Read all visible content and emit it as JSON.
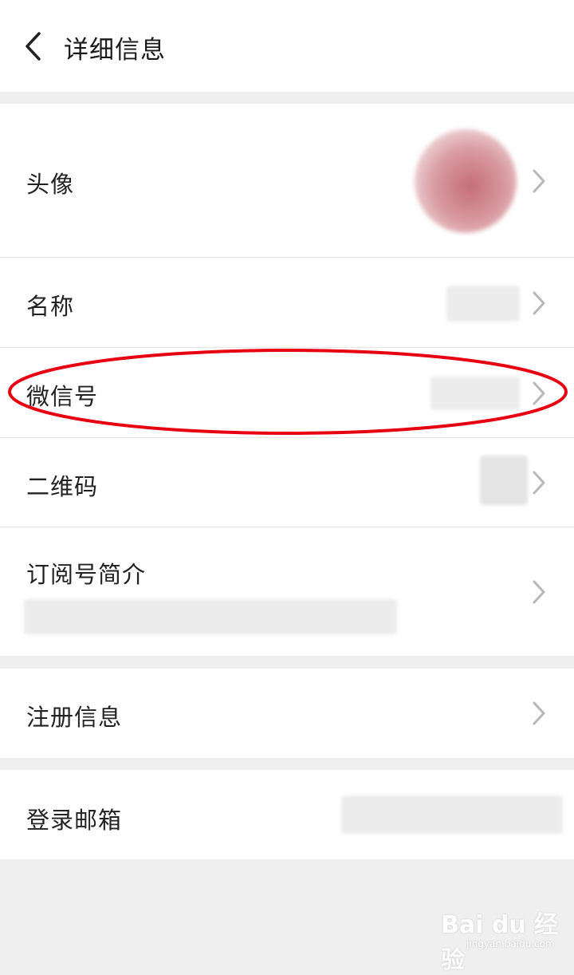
{
  "header": {
    "title": "详细信息",
    "back_icon": "chevron-left-icon"
  },
  "rows": {
    "avatar": {
      "label": "头像"
    },
    "name": {
      "label": "名称"
    },
    "wechat_id": {
      "label": "微信号"
    },
    "qr_code": {
      "label": "二维码"
    },
    "intro": {
      "label": "订阅号简介"
    },
    "registration": {
      "label": "注册信息"
    },
    "email": {
      "label": "登录邮箱"
    }
  },
  "annotation": {
    "highlight_color": "#e60012"
  },
  "watermark": {
    "text": "Bai du 经验",
    "sub": "jingyan.baidu.com"
  },
  "colors": {
    "background": "#efefef",
    "card": "#ffffff",
    "text": "#222222",
    "chevron": "#b8b8b8"
  }
}
